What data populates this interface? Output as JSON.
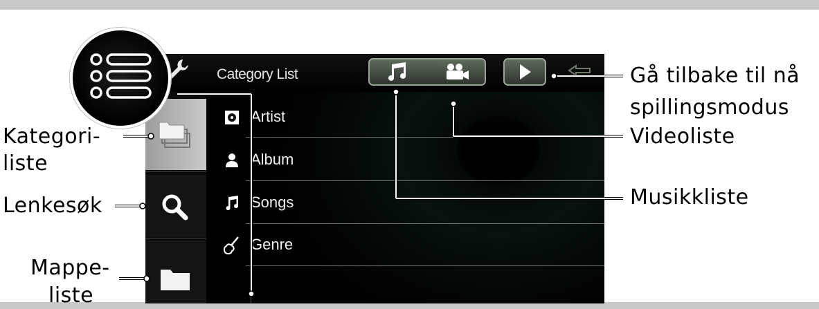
{
  "screen": {
    "title": "Category List",
    "list": {
      "items": [
        {
          "label": "Artist",
          "icon": "artist-icon"
        },
        {
          "label": "Album",
          "icon": "album-icon"
        },
        {
          "label": "Songs",
          "icon": "music-note-icon"
        },
        {
          "label": "Genre",
          "icon": "guitar-icon"
        }
      ]
    },
    "sidebar": {
      "items": [
        {
          "name": "category-list",
          "icon": "folders-icon",
          "selected": true
        },
        {
          "name": "link-search",
          "icon": "search-icon",
          "selected": false
        },
        {
          "name": "folder-list",
          "icon": "folder-icon",
          "selected": false
        }
      ]
    },
    "toolbar": {
      "music_tab_icon": "music-note-icon",
      "video_tab_icon": "video-camera-icon",
      "play_icon": "play-icon"
    }
  },
  "callouts": {
    "category_line1": "Kategori-",
    "category_line2": "liste",
    "search": "Lenkesøk",
    "folder_line1": "Mappe-",
    "folder_line2": "liste",
    "back_line1": "Gå tilbake til nå",
    "back_line2": "spillingsmodus",
    "video": "Videoliste",
    "music": "Musikkliste"
  },
  "colors": {
    "screen_bg": "#030303",
    "dots": "#5abe6e",
    "sidebar_selected": "#c9c9c9",
    "callout_text": "#000000"
  }
}
